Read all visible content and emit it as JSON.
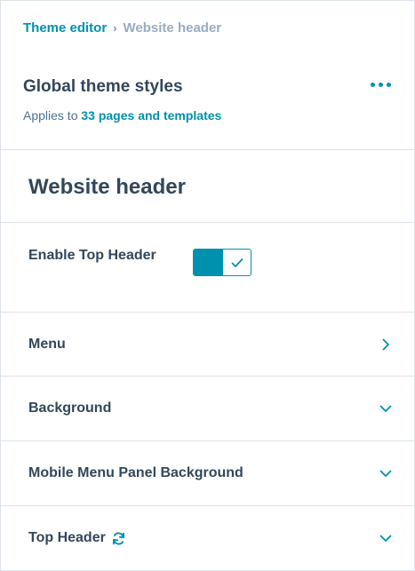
{
  "breadcrumb": {
    "parent": "Theme editor",
    "separator": "›",
    "current": "Website header"
  },
  "global_styles": {
    "title": "Global theme styles",
    "applies_prefix": "Applies to",
    "applies_link": "33 pages and templates",
    "more_icon": "more-horizontal-icon"
  },
  "section": {
    "title": "Website header"
  },
  "enable_top_header": {
    "label": "Enable Top Header",
    "enabled": true
  },
  "rows": [
    {
      "label": "Menu",
      "icon": "chevron-right-icon"
    },
    {
      "label": "Background",
      "icon": "chevron-down-icon"
    },
    {
      "label": "Mobile Menu Panel Background",
      "icon": "chevron-down-icon"
    },
    {
      "label": "Top Header",
      "icon": "chevron-down-icon",
      "status_icon": "sync-icon"
    }
  ],
  "colors": {
    "accent": "#0091ae",
    "text": "#33475b",
    "divider": "#dfe3eb"
  }
}
